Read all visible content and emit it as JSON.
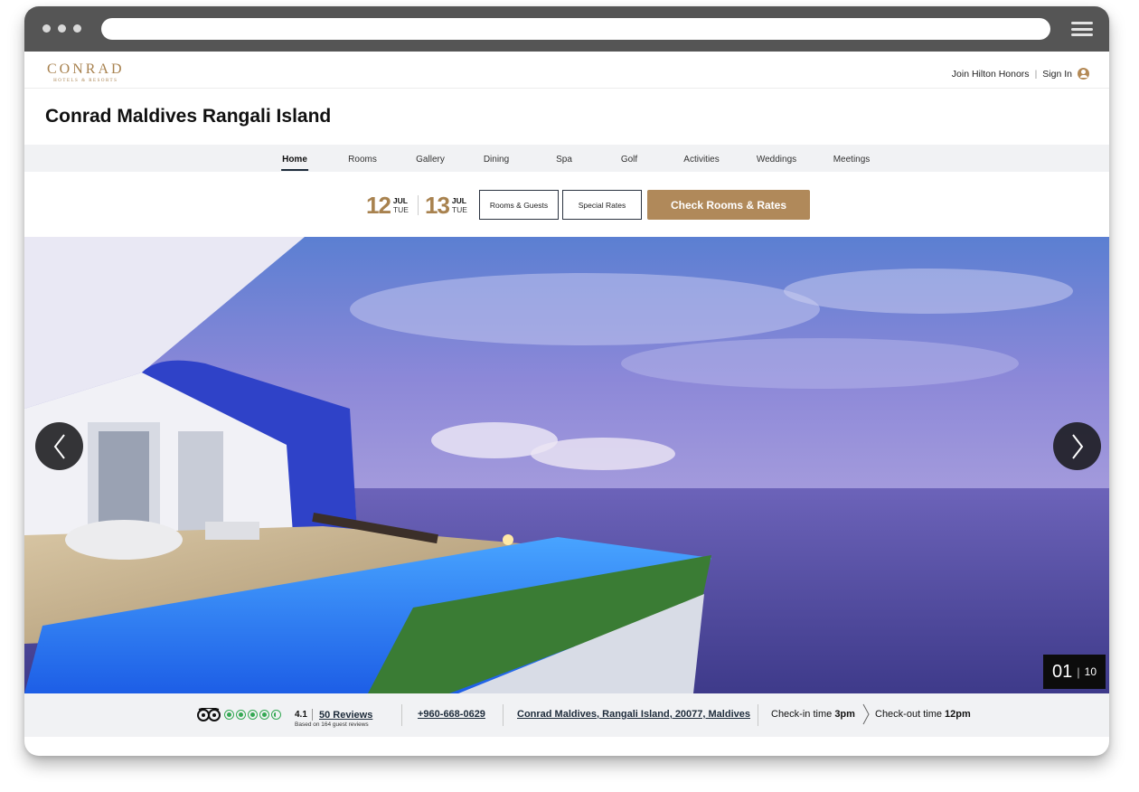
{
  "header": {
    "logo_word": "CONRAD",
    "logo_sub": "HOTELS & RESORTS",
    "join_label": "Join Hilton Honors",
    "separator": "|",
    "signin_label": "Sign In"
  },
  "hotel": {
    "title": "Conrad Maldives Rangali Island"
  },
  "nav": {
    "items": [
      {
        "label": "Home",
        "active": true
      },
      {
        "label": "Rooms"
      },
      {
        "label": "Gallery"
      },
      {
        "label": "Dining"
      },
      {
        "label": "Spa"
      },
      {
        "label": "Golf"
      },
      {
        "label": "Activities"
      },
      {
        "label": "Weddings"
      },
      {
        "label": "Meetings"
      }
    ]
  },
  "booking": {
    "checkin": {
      "day": "12",
      "month": "JUL",
      "weekday": "TUE"
    },
    "checkout": {
      "day": "13",
      "month": "JUL",
      "weekday": "TUE"
    },
    "rooms_guests_label": "Rooms & Guests",
    "special_rates_label": "Special Rates",
    "check_rates_label": "Check Rooms & Rates"
  },
  "carousel": {
    "current": "01",
    "separator": "|",
    "total": "10",
    "prev_icon": "chevron-left-icon",
    "next_icon": "chevron-right-icon"
  },
  "footer": {
    "rating": "4.1",
    "reviews_label": "50 Reviews",
    "based_on": "Based on 164 guest reviews",
    "bubbles": 4.5,
    "phone": "+960-668-0629",
    "address": "Conrad Maldives, Rangali Island, 20077, Maldives",
    "checkin_label": "Check-in time",
    "checkin_time": "3pm",
    "checkout_label": "Check-out time",
    "checkout_time": "12pm"
  },
  "colors": {
    "brand_gold": "#a8824f",
    "button_gold": "#b0895a",
    "navy": "#1d2b3a",
    "tripadvisor_green": "#34a853"
  }
}
